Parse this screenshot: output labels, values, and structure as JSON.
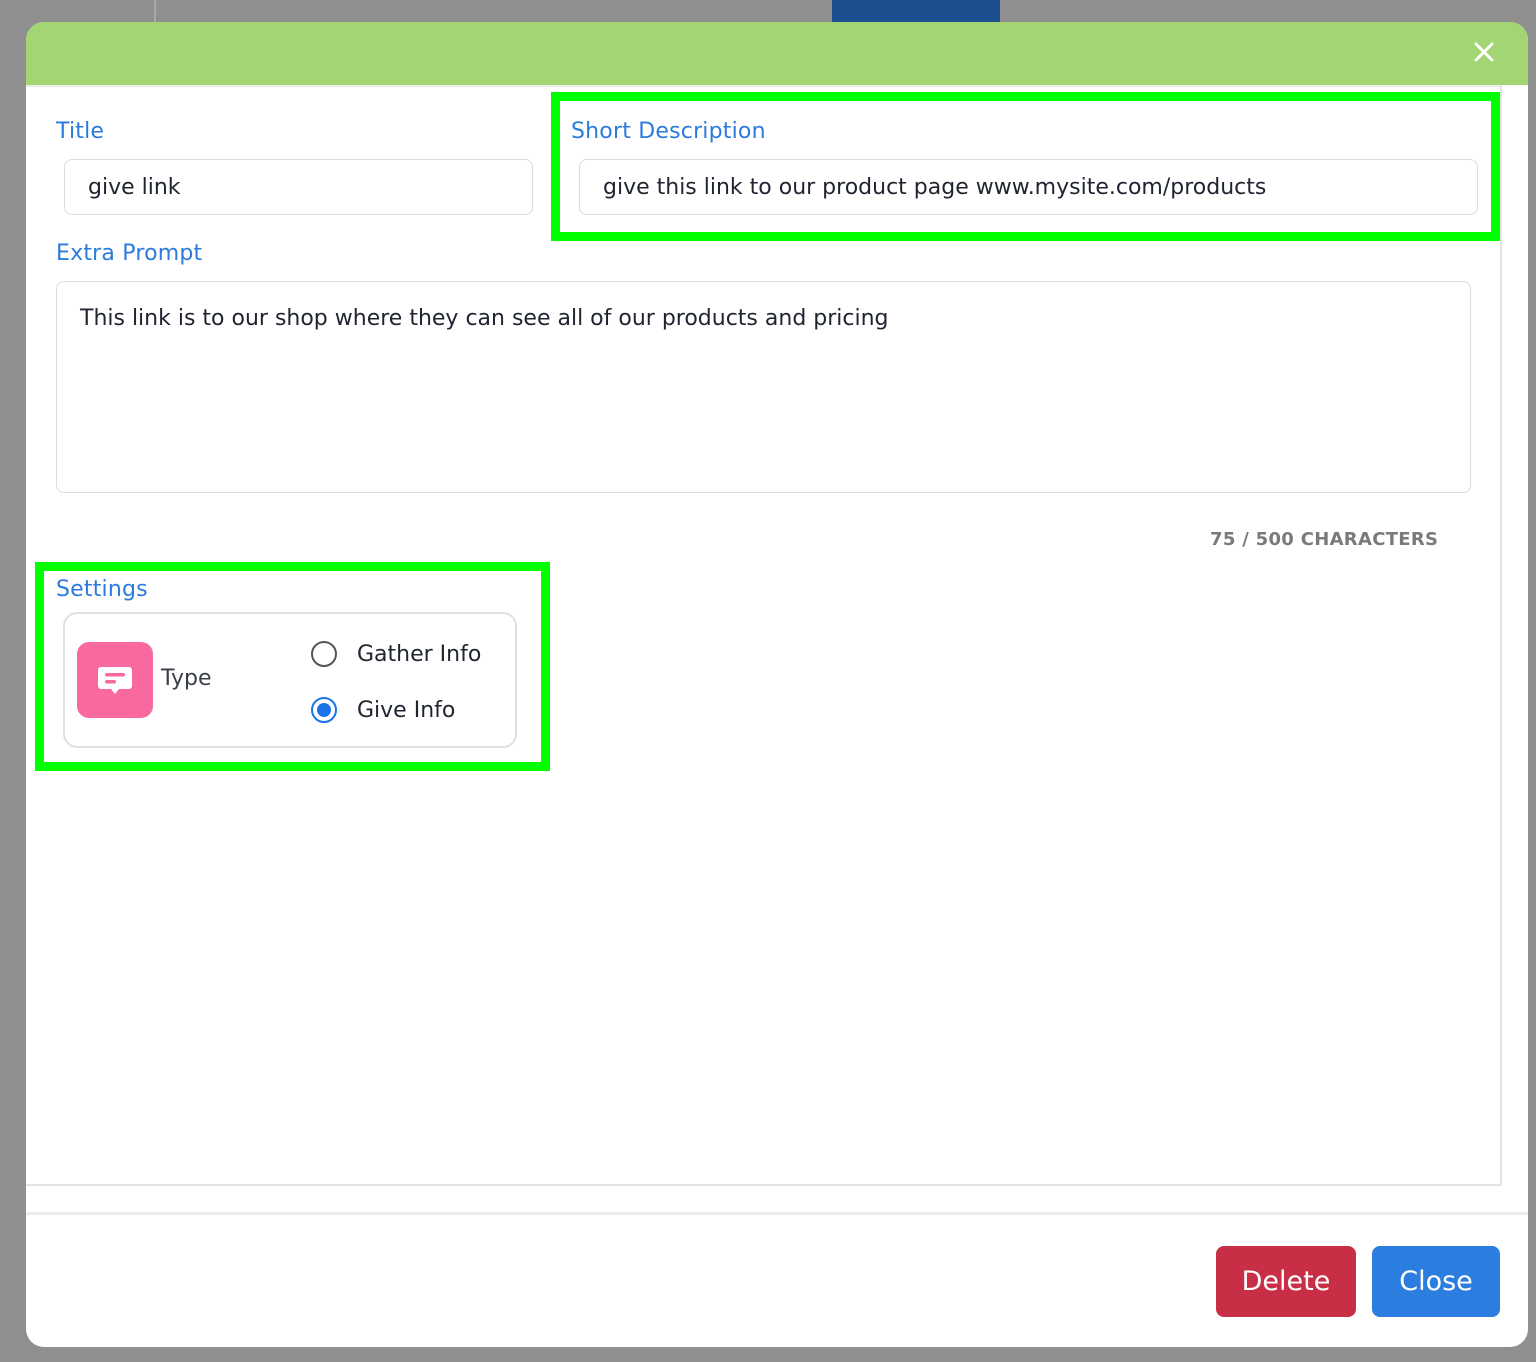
{
  "modal": {
    "header_color": "#a3d572",
    "close_icon": "close-icon"
  },
  "form": {
    "title": {
      "label": "Title",
      "value": "give link"
    },
    "short_description": {
      "label": "Short Description",
      "value": "give this link to our product page www.mysite.com/products"
    },
    "extra_prompt": {
      "label": "Extra Prompt",
      "value": "This link is to our shop where they can see all of our products and pricing",
      "char_count": "75 / 500 CHARACTERS"
    }
  },
  "settings": {
    "label": "Settings",
    "type_label": "Type",
    "type_icon": "chat-bubble-icon",
    "options": [
      {
        "label": "Gather Info",
        "checked": false
      },
      {
        "label": "Give Info",
        "checked": true
      }
    ]
  },
  "footer": {
    "delete_label": "Delete",
    "close_label": "Close"
  },
  "colors": {
    "accent": "#2b7bdc",
    "highlight": "#00ff00",
    "delete": "#c82e45",
    "close": "#2c7de0",
    "type_icon_bg": "#f7699f"
  }
}
